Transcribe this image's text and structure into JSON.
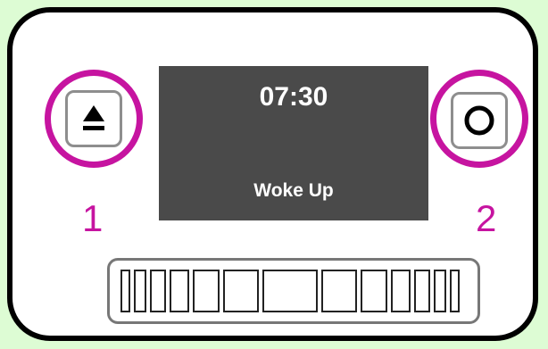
{
  "screen": {
    "time": "07:30",
    "status": "Woke Up"
  },
  "buttons": [
    {
      "label": "1",
      "icon": "eject-icon"
    },
    {
      "label": "2",
      "icon": "record-circle-icon"
    }
  ],
  "colors": {
    "background": "#ddfcd4",
    "highlight_ring": "#c614a0",
    "screen": "#4a4a4a"
  },
  "slot": {
    "segments": 13
  }
}
